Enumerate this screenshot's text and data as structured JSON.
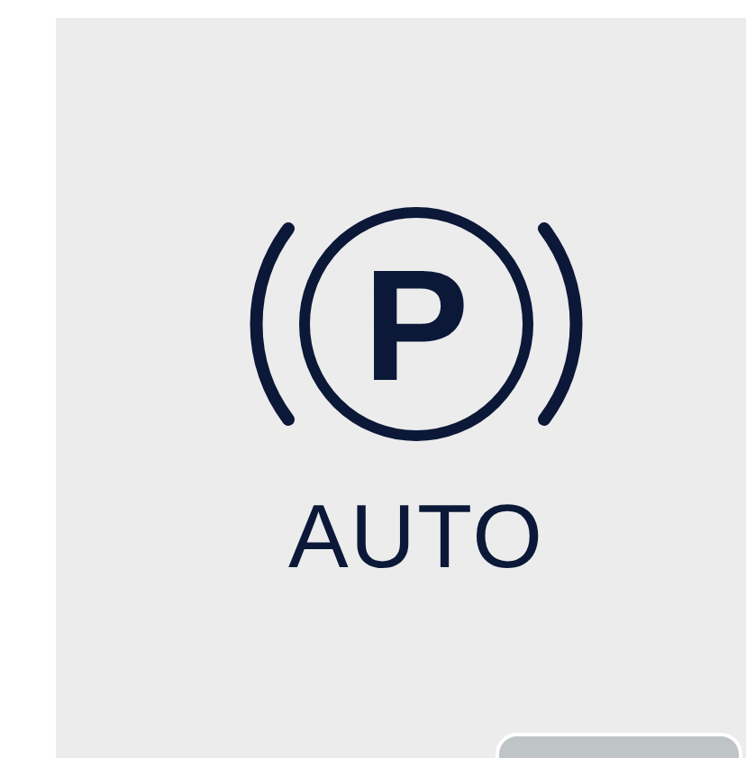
{
  "indicator": {
    "symbol": "P",
    "label": "AUTO"
  }
}
